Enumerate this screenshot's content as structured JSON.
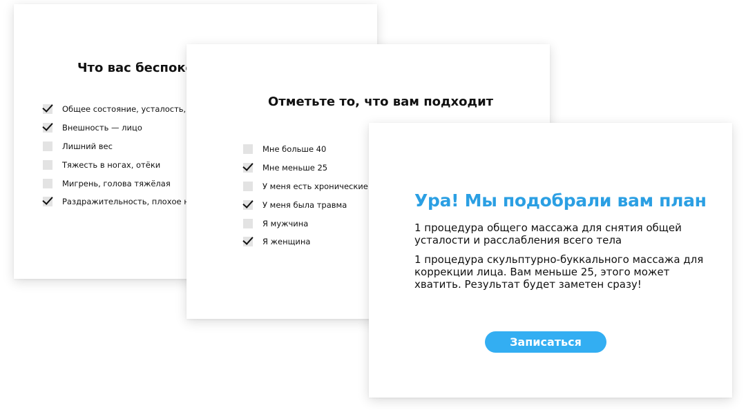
{
  "cards": [
    {
      "title": "Что вас беспокоит?",
      "options": [
        {
          "label": "Общее состояние, усталость, недосып",
          "checked": true
        },
        {
          "label": "Внешность — лицо",
          "checked": true
        },
        {
          "label": "Лишний вес",
          "checked": false
        },
        {
          "label": "Тяжесть в ногах, отёки",
          "checked": false
        },
        {
          "label": "Мигрень, голова тяжёлая",
          "checked": false
        },
        {
          "label": "Раздражительность, плохое настроение",
          "checked": true
        }
      ]
    },
    {
      "title": "Отметьте то, что вам подходит",
      "options": [
        {
          "label": "Мне больше 40",
          "checked": false
        },
        {
          "label": "Мне меньше 25",
          "checked": true
        },
        {
          "label": "У меня есть хронические заболевания",
          "checked": false
        },
        {
          "label": "У меня была травма",
          "checked": true
        },
        {
          "label": "Я мужчина",
          "checked": false
        },
        {
          "label": "Я женщина",
          "checked": true
        }
      ]
    }
  ],
  "result": {
    "title": "Ура! Мы подобрали вам план",
    "p1": "1 процедура общего массажа для снятия общей усталости и расслабления всего тела",
    "p2": "1 процедура скульптурно-буккального массажа для коррекции лица. Вам меньше 25, этого может хватить. Результат будет заметен сразу!",
    "button_label": "Записаться"
  },
  "colors": {
    "accent": "#2b9fe3",
    "button_bg": "#33aef2",
    "checkbox_bg": "#e3e3e3"
  }
}
